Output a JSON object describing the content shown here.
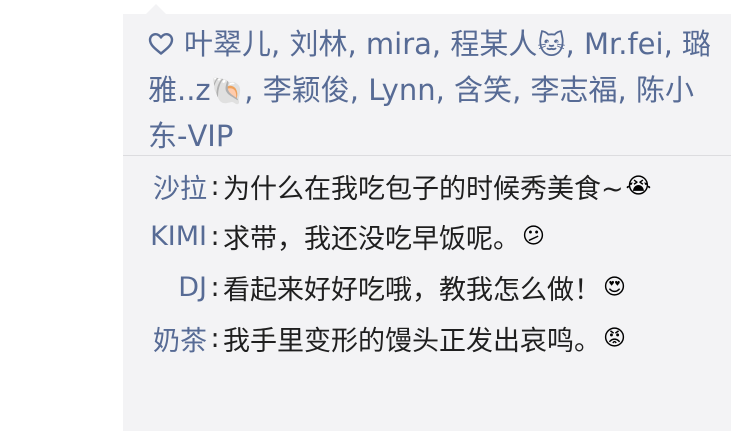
{
  "likes": {
    "icon": "heart-outline-icon",
    "names": [
      {
        "name": "叶翠儿",
        "emoji": ""
      },
      {
        "name": "刘林",
        "emoji": ""
      },
      {
        "name": "mira",
        "emoji": ""
      },
      {
        "name": "程某人",
        "emoji": "🐱"
      },
      {
        "name": "Mr.fei",
        "emoji": ""
      },
      {
        "name": "璐雅..z",
        "emoji": "🐚"
      },
      {
        "name": "李颖俊",
        "emoji": ""
      },
      {
        "name": "Lynn",
        "emoji": ""
      },
      {
        "name": "含笑",
        "emoji": ""
      },
      {
        "name": "李志福",
        "emoji": ""
      },
      {
        "name": "陈小东-VIP",
        "emoji": ""
      }
    ],
    "separator": ", "
  },
  "comments": [
    {
      "author": "沙拉",
      "colon": ":",
      "text": "为什么在我吃包子的时候秀美食~",
      "emoji": "😭"
    },
    {
      "author": "KIMI",
      "colon": ":",
      "text": "求带，我还没吃早饭呢。",
      "emoji": "😕"
    },
    {
      "author": "DJ",
      "colon": ":",
      "text": "看起来好好吃哦，教我怎么做！",
      "emoji": "😍"
    },
    {
      "author": "奶茶",
      "colon": ":",
      "text": "我手里变形的馒头正发出哀鸣。",
      "emoji": "😡"
    }
  ],
  "colors": {
    "name_link": "#576b95",
    "card_bg": "#f3f3f5",
    "text": "#1f1f1f"
  }
}
